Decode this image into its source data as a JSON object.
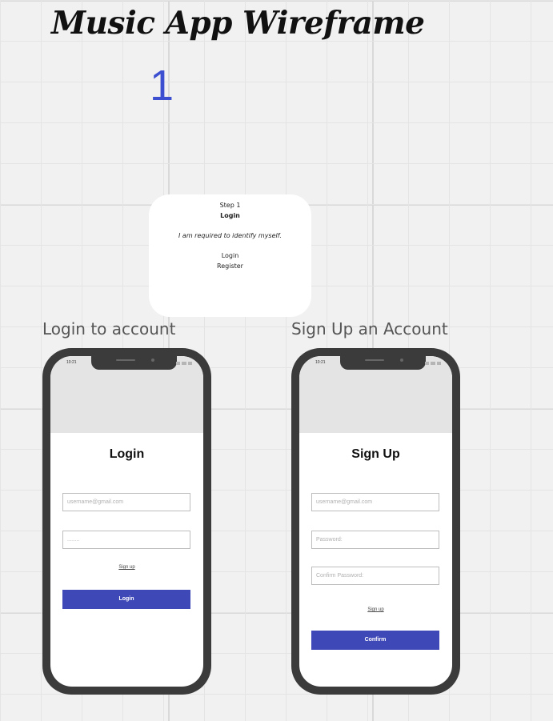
{
  "board": {
    "title": "Music App Wireframe",
    "step_number": "1"
  },
  "sticky_card": {
    "step_label": "Step 1",
    "title": "Login",
    "description": "I am required to identify myself.",
    "option_login": "Login",
    "option_register": "Register"
  },
  "login_frame": {
    "heading": "Login to account",
    "status_time": "10:21",
    "form_title": "Login",
    "username_placeholder": "username@gmail.com",
    "password_value": "........",
    "signup_link": "Sign up",
    "submit_label": "Login"
  },
  "signup_frame": {
    "heading": "Sign Up an Account",
    "status_time": "10:21",
    "form_title": "Sign Up",
    "username_placeholder": "username@gmail.com",
    "password_placeholder": "Password:",
    "confirm_placeholder": "Confirm Password:",
    "signup_link": "Sign up",
    "submit_label": "Confirm"
  },
  "colors": {
    "accent": "#3c4fd1",
    "button": "#3f48b7",
    "phone_frame": "#3b3b3b",
    "canvas": "#f1f1f1"
  }
}
